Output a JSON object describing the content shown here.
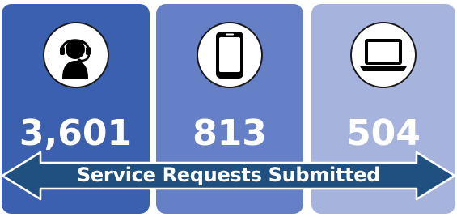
{
  "stats": [
    {
      "value": "3,601",
      "icon": "headset-agent-icon"
    },
    {
      "value": "813",
      "icon": "smartphone-icon"
    },
    {
      "value": "504",
      "icon": "laptop-icon"
    }
  ],
  "banner": {
    "label": "Service Requests Submitted"
  },
  "colors": {
    "panel_1": "#3c60b0",
    "panel_2": "#6680c8",
    "panel_3": "#a5b3dd",
    "arrow_fill": "#1f5080",
    "text": "#ffffff"
  }
}
